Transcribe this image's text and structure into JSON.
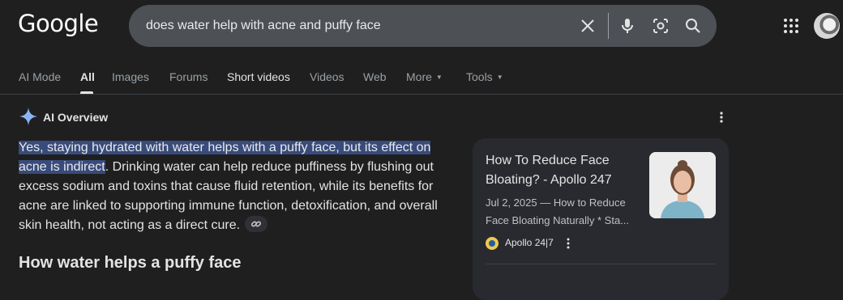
{
  "header": {
    "logo_text": "Google",
    "search_query": "does water help with acne and puffy face"
  },
  "icons": {
    "clear": "close-icon",
    "voice": "mic-icon",
    "lens": "lens-icon",
    "search": "search-icon",
    "apps": "apps-grid-icon",
    "ai": "sparkle-icon"
  },
  "tabs": {
    "ai_mode": "AI Mode",
    "all": "All",
    "images": "Images",
    "forums": "Forums",
    "short_videos": "Short videos",
    "videos": "Videos",
    "web": "Web",
    "more": "More",
    "tools": "Tools"
  },
  "ai_overview": {
    "label": "AI Overview",
    "highlighted_text": "Yes, staying hydrated with water helps with a puffy face, but its effect on acne is indirect",
    "body_text": ". Drinking water can help reduce puffiness by flushing out excess sodium and toxins that cause fluid retention, while its benefits for acne are linked to supporting immune function, detoxification, and overall skin health, not acting as a direct cure.",
    "section_heading": "How water helps a puffy face"
  },
  "source_card": {
    "title": "How To Reduce Face Bloating? - Apollo 247",
    "snippet": "Jul 2, 2025 — How to Reduce Face Bloating Naturally * Sta...",
    "source_name": "Apollo 24|7"
  },
  "colors": {
    "background": "#1f1f1f",
    "search_box": "#4d5156",
    "highlight": "#394b7a",
    "card": "#282a2f",
    "ai_sparkle": "#8ab4f8"
  }
}
